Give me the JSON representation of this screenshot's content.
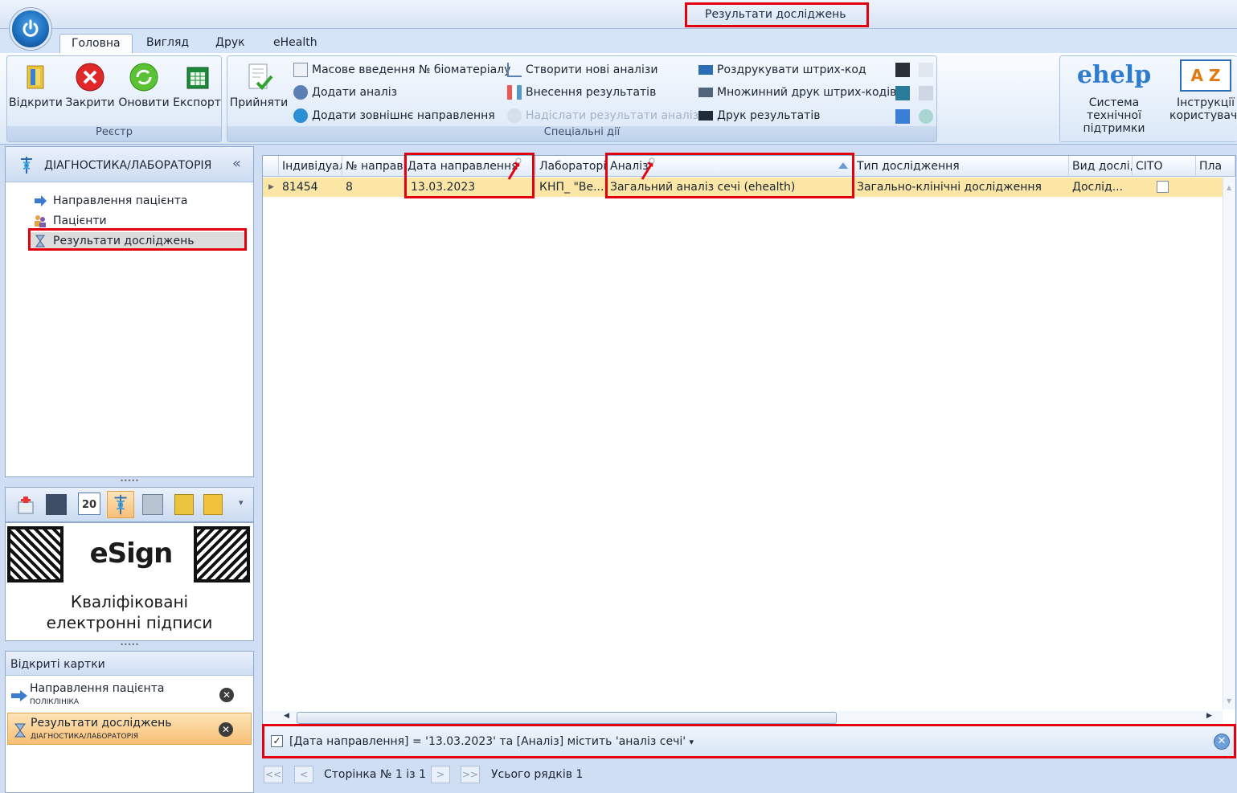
{
  "window": {
    "title": "Результати досліджень"
  },
  "tabs": [
    "Головна",
    "Вигляд",
    "Друк",
    "eHealth"
  ],
  "ribbon": {
    "registry": {
      "label": "Реєстр",
      "buttons": [
        "Відкрити",
        "Закрити",
        "Оновити",
        "Експорт"
      ]
    },
    "special": {
      "label": "Спеціальні дії",
      "accept": "Прийняти",
      "col1": [
        "Масове введення № біоматеріалу",
        "Додати аналіз",
        "Додати зовнішнє направлення"
      ],
      "col2": [
        "Створити нові аналізи",
        "Внесення результатів",
        "Надіслати результати аналізів"
      ],
      "col3": [
        "Роздрукувати штрих-код",
        "Множинний друк штрих-кодів",
        "Друк результатів"
      ]
    },
    "help": {
      "ehelp_logo": "ehelp",
      "support": [
        "Система технічної",
        "підтримки"
      ],
      "az": "A Z",
      "manual": [
        "Інструкції",
        "користувача"
      ]
    }
  },
  "nav": {
    "title": "ДІАГНОСТИКА/ЛАБОРАТОРІЯ",
    "collapse": "«",
    "items": [
      "Направлення пацієнта",
      "Пацієнти",
      "Результати досліджень"
    ],
    "selected": 2
  },
  "iconbar": {
    "calendar_text": "20",
    "more": "▾"
  },
  "esign": {
    "logo": "eSign",
    "line1": "Кваліфіковані",
    "line2": "електронні підписи"
  },
  "opened": {
    "header": "Відкриті картки",
    "cards": [
      {
        "title": "Направлення пацієнта",
        "subtitle": "ПОЛІКЛІНІКА",
        "close": "✕"
      },
      {
        "title": "Результати досліджень",
        "subtitle": "ДІАГНОСТИКА/ЛАБОРАТОРІЯ",
        "close": "✕"
      }
    ]
  },
  "grid": {
    "columns": [
      "Індивідуал",
      "№ направ",
      "Дата направлення",
      "Лабораторі",
      "Аналіз",
      "Тип дослідження",
      "Вид дослі,",
      "CITO",
      "Пла"
    ],
    "rows": [
      {
        "id": "81454",
        "num": "8",
        "date": "13.03.2023",
        "lab": "КНП_ \"Ве...",
        "analysis": "Загальний аналіз сечі (ehealth)",
        "type": "Загально-клінічні дослідження",
        "kind": "Дослід...",
        "cito": false
      }
    ]
  },
  "filter": {
    "text": "[Дата направлення] = '13.03.2023' та [Аналіз] містить 'аналіз сечі'",
    "dropdown": "▾",
    "checked": true
  },
  "pager": {
    "first": "<<",
    "prev": "<",
    "page_text": "Сторінка № 1 із 1",
    "next": ">",
    "last": ">>",
    "total": "Усього рядків 1"
  },
  "colors": {
    "accent": "#1d6fbf",
    "highlight_row": "#fbe6a6",
    "red_box": "#e3000f"
  }
}
